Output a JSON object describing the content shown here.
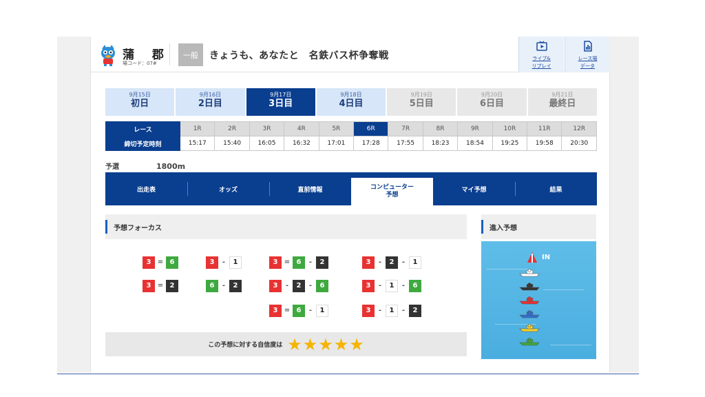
{
  "header": {
    "venue_name": "蒲 郡",
    "venue_code": "場コード：07#",
    "grade": "一般",
    "race_title": "きょうも、あなたと　名鉄バス杯争奪戦",
    "buttons": [
      {
        "icon": "play-video-icon",
        "label_line1": "ライブ&",
        "label_line2": "リプレイ"
      },
      {
        "icon": "chart-data-icon",
        "label_line1": "レース場",
        "label_line2": "データ"
      }
    ]
  },
  "days": [
    {
      "date": "9月15日",
      "name": "初日",
      "state": "past"
    },
    {
      "date": "9月16日",
      "name": "2日目",
      "state": "past"
    },
    {
      "date": "9月17日",
      "name": "3日目",
      "state": "current"
    },
    {
      "date": "9月18日",
      "name": "4日目",
      "state": "past"
    },
    {
      "date": "9月19日",
      "name": "5日目",
      "state": "future"
    },
    {
      "date": "9月20日",
      "name": "6日目",
      "state": "future"
    },
    {
      "date": "9月21日",
      "name": "最終日",
      "state": "future"
    }
  ],
  "race_table": {
    "race_header": "レース",
    "time_header": "締切予定時刻",
    "races": [
      "1R",
      "2R",
      "3R",
      "4R",
      "5R",
      "6R",
      "7R",
      "8R",
      "9R",
      "10R",
      "11R",
      "12R"
    ],
    "current_race": "6R",
    "times": [
      "15:17",
      "15:40",
      "16:05",
      "16:32",
      "17:01",
      "17:28",
      "17:55",
      "18:23",
      "18:54",
      "19:25",
      "19:58",
      "20:30"
    ]
  },
  "meta": {
    "race_type": "予選",
    "distance": "1800m"
  },
  "nav_tabs": [
    {
      "label": "出走表",
      "active": false
    },
    {
      "label": "オッズ",
      "active": false
    },
    {
      "label": "直前情報",
      "active": false
    },
    {
      "label": "コンピューター\n予想",
      "label_line1": "コンピューター",
      "label_line2": "予想",
      "active": true
    },
    {
      "label": "マイ予想",
      "active": false
    },
    {
      "label": "結果",
      "active": false
    }
  ],
  "focus": {
    "title": "予想フォーカス",
    "combos": [
      {
        "col": 0,
        "row": 0,
        "items": [
          "3",
          "=",
          "6"
        ]
      },
      {
        "col": 1,
        "row": 0,
        "items": [
          "3",
          "-",
          "1"
        ]
      },
      {
        "col": 2,
        "row": 0,
        "items": [
          "3",
          "=",
          "6",
          "-",
          "2"
        ]
      },
      {
        "col": 3,
        "row": 0,
        "items": [
          "3",
          "-",
          "2",
          "-",
          "1"
        ]
      },
      {
        "col": 0,
        "row": 1,
        "items": [
          "3",
          "=",
          "2"
        ]
      },
      {
        "col": 1,
        "row": 1,
        "items": [
          "6",
          "-",
          "2"
        ]
      },
      {
        "col": 2,
        "row": 1,
        "items": [
          "3",
          "-",
          "2",
          "-",
          "6"
        ]
      },
      {
        "col": 3,
        "row": 1,
        "items": [
          "3",
          "-",
          "1",
          "-",
          "6"
        ]
      },
      {
        "col": 2,
        "row": 2,
        "items": [
          "3",
          "=",
          "6",
          "-",
          "1"
        ]
      },
      {
        "col": 3,
        "row": 2,
        "items": [
          "3",
          "-",
          "1",
          "-",
          "2"
        ]
      }
    ],
    "confidence_label": "この予想に対する自信度は",
    "confidence_stars": 5
  },
  "entry": {
    "title": "進入予想",
    "in_label": "IN",
    "boat_order": [
      "1",
      "2",
      "3",
      "4",
      "5",
      "6"
    ],
    "boat_colors": [
      "#ffffff",
      "#333333",
      "#e83232",
      "#2f6fd0",
      "#f2d22e",
      "#3fa93f"
    ]
  }
}
